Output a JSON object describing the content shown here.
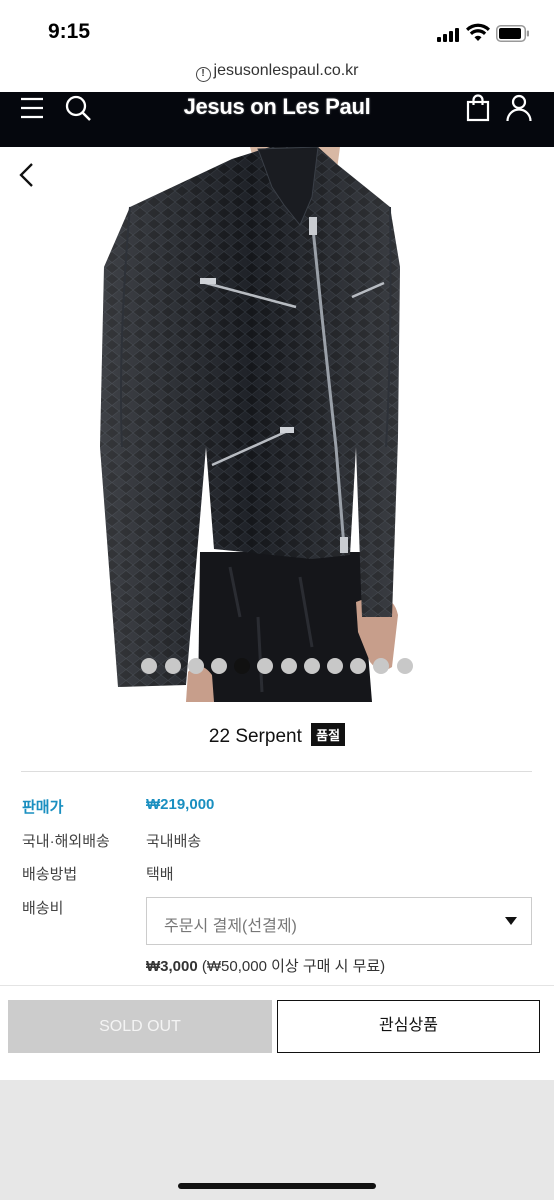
{
  "status_bar": {
    "time": "9:15"
  },
  "browser": {
    "url": "jesusonlespaul.co.kr"
  },
  "header": {
    "logo": "Jesus on Les Paul"
  },
  "gallery": {
    "slide_count": 12,
    "active_index": 4
  },
  "product": {
    "name": "22 Serpent",
    "badge": "품절",
    "price_label": "판매가",
    "price_value": "₩219,000",
    "delivery_label": "국내·해외배송",
    "delivery_value": "국내배송",
    "method_label": "배송방법",
    "method_value": "택배",
    "fee_label": "배송비",
    "fee_select": "주문시 결제(선결제)",
    "fee_amount": "₩3,000",
    "fee_note": "(₩50,000 이상 구매 시 무료)"
  },
  "buttons": {
    "sold_out": "SOLD OUT",
    "wishlist": "관심상품"
  }
}
